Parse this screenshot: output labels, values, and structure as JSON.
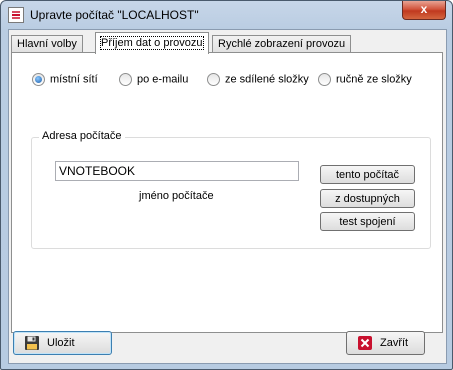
{
  "window": {
    "title": "Upravte počítač \"LOCALHOST\"",
    "close_glyph": "x",
    "accent_close": "#c0391f"
  },
  "tabs": [
    {
      "label": "Hlavní volby",
      "active": false
    },
    {
      "label": "Příjem dat o provozu",
      "active": true
    },
    {
      "label": "Rychlé zobrazení provozu",
      "active": false
    }
  ],
  "receive_mode": {
    "options": [
      {
        "label": "místní sítí",
        "selected": true
      },
      {
        "label": "po e-mailu",
        "selected": false
      },
      {
        "label": "ze sdílené složky",
        "selected": false
      },
      {
        "label": "ručně ze složky",
        "selected": false
      }
    ]
  },
  "address_group": {
    "legend": "Adresa počítače",
    "computer_name_value": "VNOTEBOOK",
    "computer_name_caption": "jméno počítače",
    "buttons": {
      "this_computer": "tento počítač",
      "from_available": "z dostupných",
      "test_connection": "test spojení"
    }
  },
  "footer": {
    "save_label": "Uložit",
    "close_label": "Zavřít"
  },
  "icons": {
    "app": "app-icon",
    "save": "floppy-disk-icon",
    "close": "red-x-icon"
  }
}
